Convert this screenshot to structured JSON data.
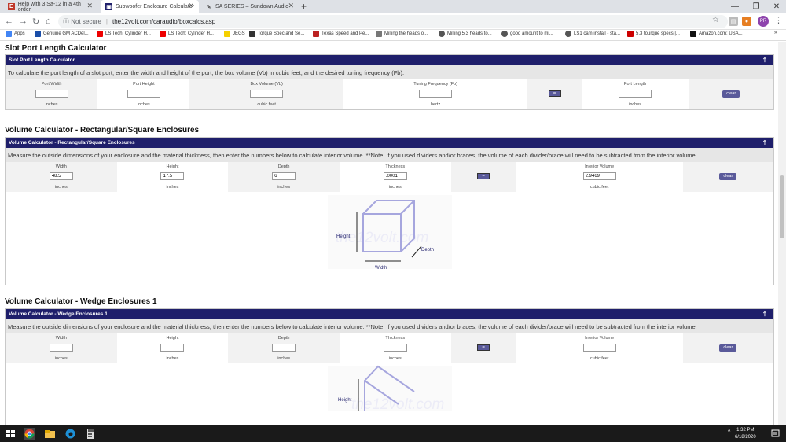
{
  "browser": {
    "tabs": [
      {
        "label": "Help with 3 Sa-12 in a 4th order"
      },
      {
        "label": "Subwoofer Enclosure Calculator"
      },
      {
        "label": "SA SERIES – Sundown Audio"
      }
    ],
    "security": "Not secure",
    "url": "the12volt.com/caraudio/boxcalcs.asp",
    "profile": "PR",
    "bookmarks": [
      "Apps",
      "Genuine GM ACDel...",
      "LS Tech: Cylinder H...",
      "LS Tech: Cylinder H...",
      "JEGS",
      "Torque Spec and Se...",
      "Texas Speed and Pe...",
      "Milling the heads o...",
      "Milling 5.3 heads to...",
      "good amount to mi...",
      "LS1 cam install - sta...",
      "5.3 tourque specs |...",
      "Amazon.com: USA..."
    ]
  },
  "slot": {
    "heading": "Slot Port Length Calculator",
    "panel_title": "Slot Port Length Calculator",
    "desc": "To calculate the port length of a slot port, enter the width and height of the port, the box volume (Vb) in cubic feet, and the desired tuning frequency (Fb).",
    "labels": [
      "Port Width",
      "Port Height",
      "Box Volume (Vb)",
      "Tuning Frequency (Fb)",
      "Port Length"
    ],
    "units": [
      "inches",
      "inches",
      "cubic feet",
      "hertz",
      "inches"
    ],
    "eq": "=",
    "clear": "clear"
  },
  "rect": {
    "heading": "Volume Calculator - Rectangular/Square Enclosures",
    "panel_title": "Volume Calculator - Rectangular/Square Enclosures",
    "desc": "Measure the outside dimensions of your enclosure and the material thickness, then enter the numbers below to calculate interior volume. **Note: If you used dividers and/or braces, the volume of each divider/brace will need to be subtracted from the interior volume.",
    "labels": [
      "Width",
      "Height",
      "Depth",
      "Thickness",
      "Interior Volume"
    ],
    "values": [
      "48.5",
      "17.5",
      "6",
      ".0001",
      "2.9469"
    ],
    "units": [
      "inches",
      "inches",
      "inches",
      "inches",
      "cubic feet"
    ],
    "eq": "=",
    "clear": "clear",
    "diagram": {
      "height": "Height",
      "depth": "Depth",
      "width": "Width",
      "watermark": "the12volt.com"
    }
  },
  "wedge": {
    "heading": "Volume Calculator - Wedge Enclosures 1",
    "panel_title": "Volume Calculator - Wedge Enclosures 1",
    "desc": "Measure the outside dimensions of your enclosure and the material thickness, then enter the numbers below to calculate interior volume. **Note: If you used dividers and/or braces, the volume of each divider/brace will need to be subtracted from the interior volume.",
    "labels": [
      "Width",
      "Height",
      "Depth",
      "Thickness",
      "Interior Volume"
    ],
    "units": [
      "inches",
      "inches",
      "inches",
      "inches",
      "cubic feet"
    ],
    "eq": "=",
    "clear": "clear",
    "diagram": {
      "height": "Height",
      "watermark": "the12volt.com"
    }
  },
  "taskbar": {
    "time": "1:32 PM",
    "date": "6/18/2020"
  }
}
